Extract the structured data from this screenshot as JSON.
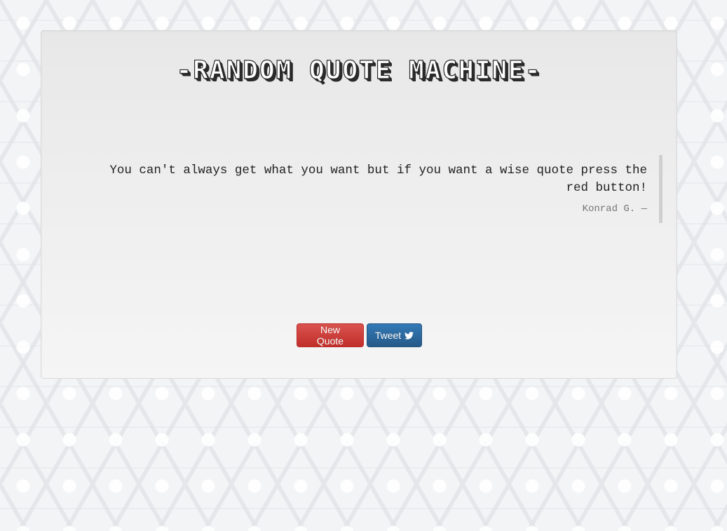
{
  "header": {
    "title": "-RANDOM QUOTE MACHINE-"
  },
  "quote": {
    "text": "You can't always get what you want but if you want a wise quote press the red button!",
    "author": "Konrad G. —"
  },
  "buttons": {
    "new_quote_label": "New Quote",
    "tweet_label": "Tweet",
    "tweet_icon": "twitter-icon"
  },
  "colors": {
    "new_quote_button": "#d9534f",
    "tweet_button": "#337ab7",
    "background": "#f3f4f6",
    "panel": "#eeeeee"
  }
}
